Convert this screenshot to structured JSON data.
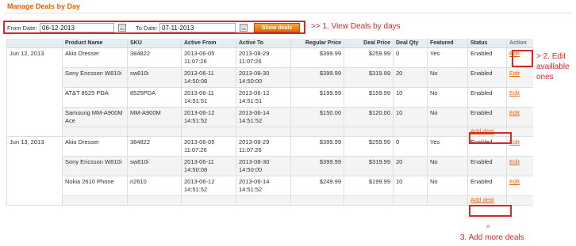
{
  "page_title": "Manage Deals by Day",
  "filter": {
    "from_label": "From Date:",
    "from_value": "06-12-2013",
    "to_label": "To Date:",
    "to_value": "07-11-2013",
    "show_button": "Show deals"
  },
  "annotations": {
    "view_deals": ">>   1. View Deals  by days",
    "edit_line1": "> 2. Edit",
    "edit_line2": "availlable",
    "edit_line3": "ones",
    "caret": "^",
    "add_more": "3. Add more deals",
    "color": "#d82727"
  },
  "table": {
    "headers": [
      "",
      "Product Name",
      "SKU",
      "Active From",
      "Active To",
      "Regular Price",
      "Deal Price",
      "Deal Qty",
      "Featured",
      "Status",
      "Action"
    ],
    "edit_label": "Edit",
    "add_label": "Add deal",
    "groups": [
      {
        "date": "Jun 12, 2013",
        "rows": [
          {
            "name": "Akio Dresser",
            "sku": "384822",
            "from": "2013-06-05 11:07:26",
            "to": "2013-08-29 11:07:26",
            "regular": "$399.99",
            "deal": "$259.99",
            "qty": "0",
            "featured": "Yes",
            "status": "Enabled"
          },
          {
            "name": "Sony Ericsson W810i",
            "sku": "sw810i",
            "from": "2013-06-11 14:50:08",
            "to": "2013-08-30 14:50:00",
            "regular": "$399.99",
            "deal": "$319.99",
            "qty": "20",
            "featured": "No",
            "status": "Enabled"
          },
          {
            "name": "AT&T 8525 PDA",
            "sku": "8525PDA",
            "from": "2013-06-11 14:51:51",
            "to": "2013-06-12 14:51:51",
            "regular": "$199.99",
            "deal": "$159.99",
            "qty": "10",
            "featured": "No",
            "status": "Enabled"
          },
          {
            "name": "Samsung MM-A900M Ace",
            "sku": "MM-A900M",
            "from": "2013-06-12 14:51:52",
            "to": "2013-06-14 14:51:52",
            "regular": "$150.00",
            "deal": "$120.00",
            "qty": "10",
            "featured": "No",
            "status": "Enabled"
          }
        ]
      },
      {
        "date": "Jun 13, 2013",
        "rows": [
          {
            "name": "Akio Dresser",
            "sku": "384822",
            "from": "2013-06-05 11:07:26",
            "to": "2013-08-29 11:07:26",
            "regular": "$399.99",
            "deal": "$259.99",
            "qty": "0",
            "featured": "Yes",
            "status": "Enabled"
          },
          {
            "name": "Sony Ericsson W810i",
            "sku": "sw810i",
            "from": "2013-06-11 14:50:08",
            "to": "2013-08-30 14:50:00",
            "regular": "$399.99",
            "deal": "$319.99",
            "qty": "20",
            "featured": "No",
            "status": "Enabled"
          },
          {
            "name": "Nokia 2610 Phone",
            "sku": "n2610",
            "from": "2013-06-12 14:51:52",
            "to": "2013-06-14 14:51:52",
            "regular": "$249.99",
            "deal": "$199.99",
            "qty": "10",
            "featured": "No",
            "status": "Enabled"
          }
        ]
      }
    ]
  }
}
